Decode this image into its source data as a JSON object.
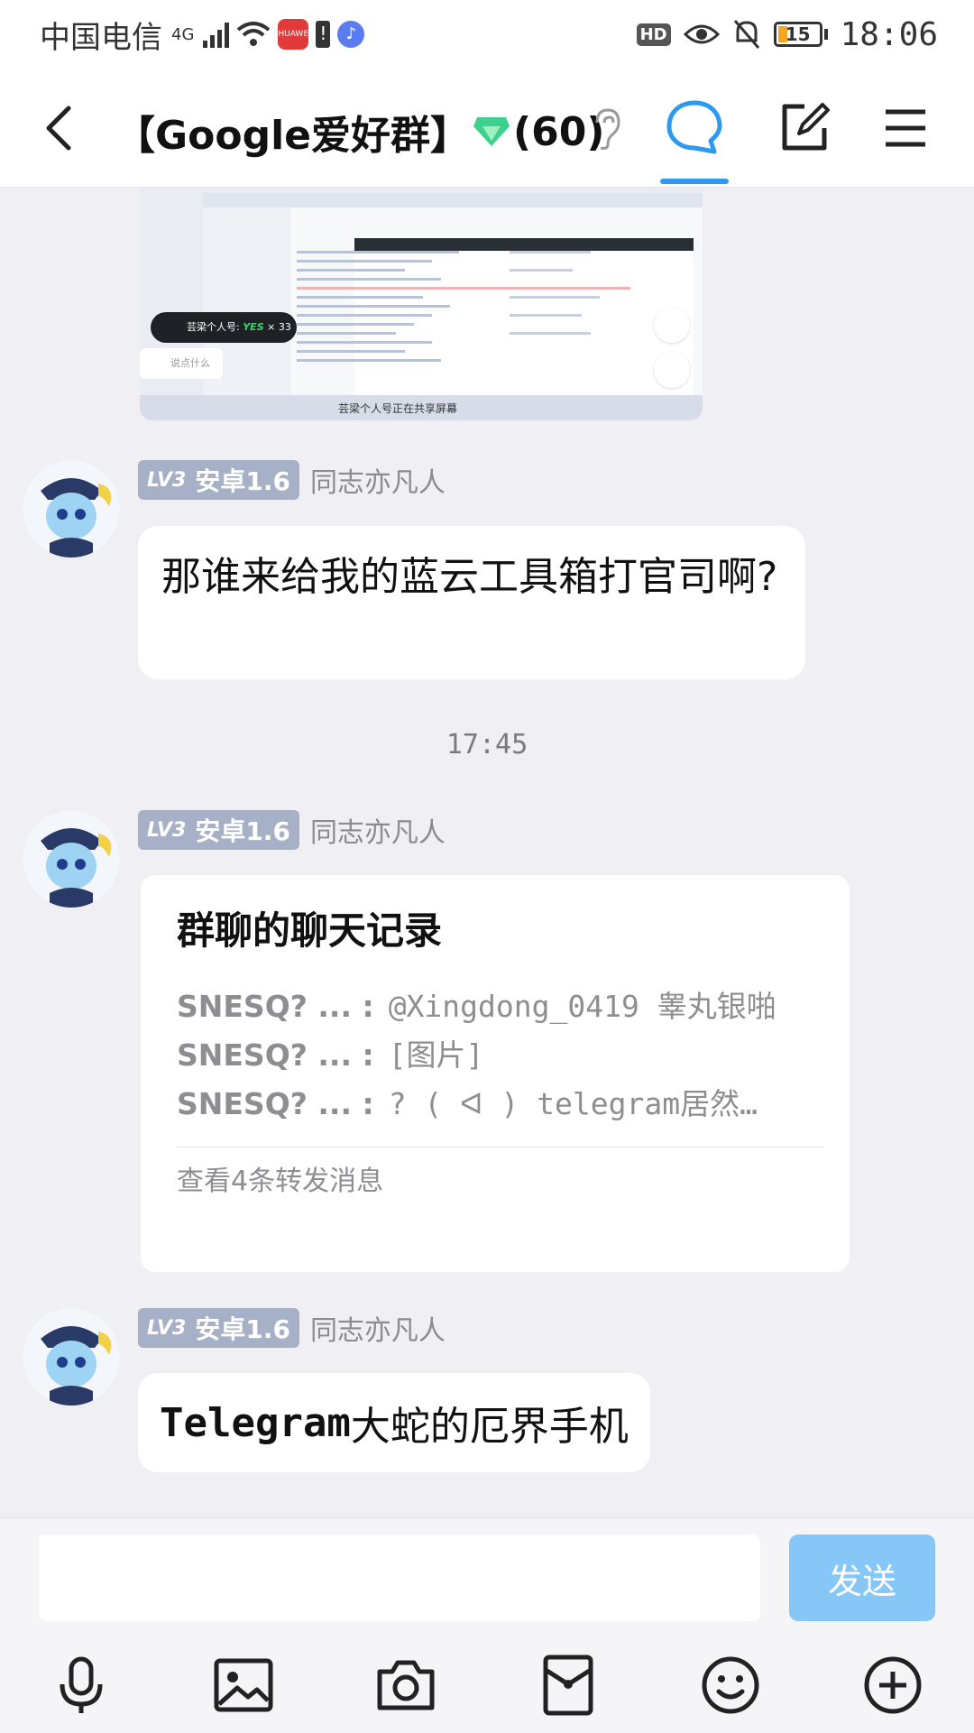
{
  "status_bar": {
    "carrier": "中国电信",
    "network": "4G",
    "clock": "18:06",
    "battery_level": "15",
    "hd_label": "HD",
    "huawei_label": "HUAWEI"
  },
  "header": {
    "title": "【Google爱好群】",
    "member_count": "(60)"
  },
  "shared_screenshot": {
    "pill_label": "芸梁个人号:",
    "pill_yes": "YES",
    "pill_count": "× 33",
    "say_placeholder": "说点什么",
    "caption": "芸梁个人号正在共享屏幕"
  },
  "messages": [
    {
      "level": "LV3",
      "title": "安卓1.6",
      "nickname": "同志亦凡人",
      "text": "那谁来给我的蓝云工具箱打官司啊?"
    },
    {
      "level": "LV3",
      "title": "安卓1.6",
      "nickname": "同志亦凡人",
      "card": {
        "title": "群聊的聊天记录",
        "lines": [
          {
            "sender": "SNESQ? ... :",
            "text": "@Xingdong_0419 睾丸银啪"
          },
          {
            "sender": "SNESQ? ... :",
            "text": "[图片]"
          },
          {
            "sender": "SNESQ? ... :",
            "text": "? ( ᐊ ) telegram居然…"
          }
        ],
        "footer": "查看4条转发消息"
      }
    },
    {
      "level": "LV3",
      "title": "安卓1.6",
      "nickname": "同志亦凡人",
      "text_mono": "Telegram",
      "text": "大蛇的厄界手机"
    }
  ],
  "timestamp": "17:45",
  "composer": {
    "value": "",
    "send_label": "发送"
  },
  "colors": {
    "accent": "#2d9af0",
    "send_disabled": "#86c7f8",
    "level_badge": "#a6b0c6",
    "background": "#efeff4"
  }
}
